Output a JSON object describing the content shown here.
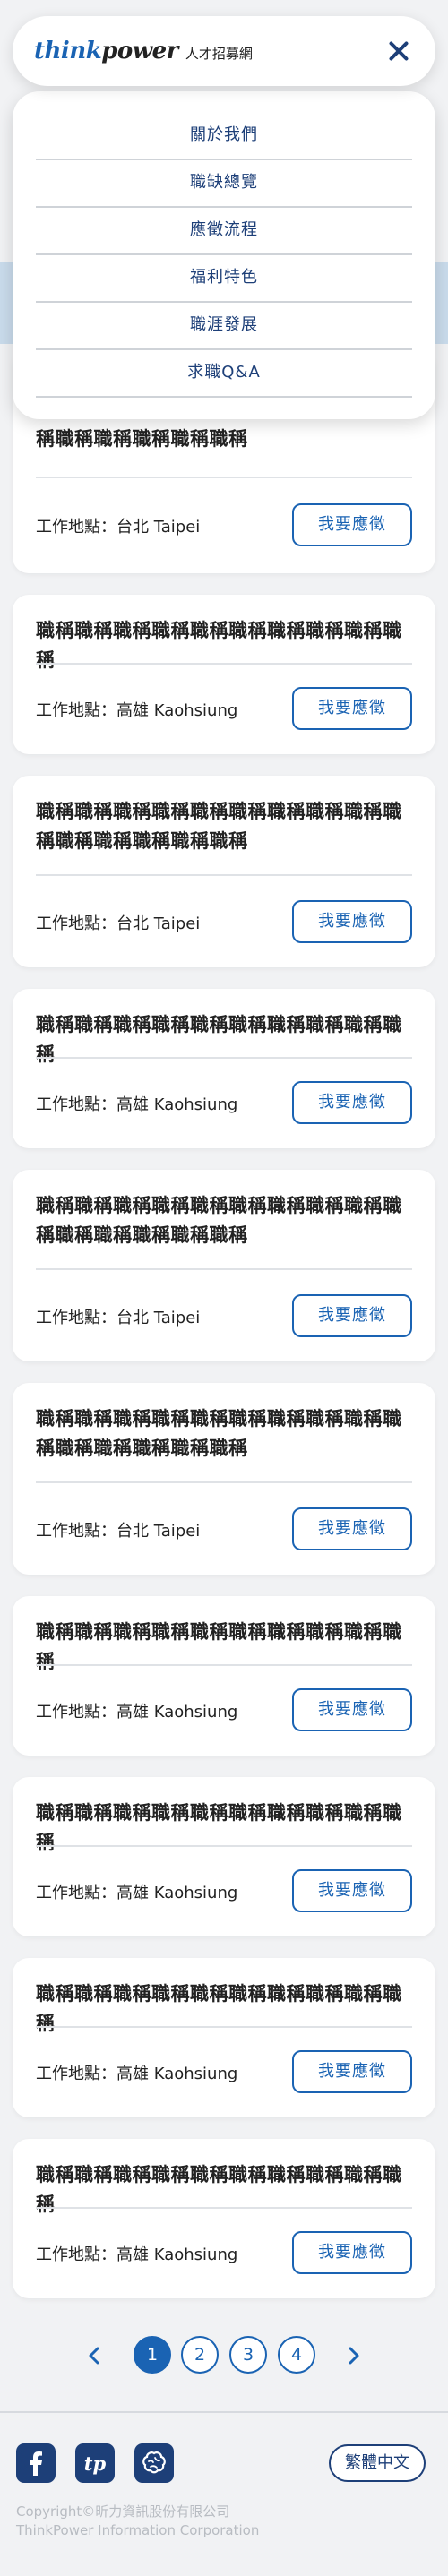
{
  "header": {
    "logo_think": "think",
    "logo_power": "power",
    "logo_sub": "人才招募網",
    "close_icon": "close-icon"
  },
  "menu": {
    "items": [
      "關於我們",
      "職缺總覽",
      "應徵流程",
      "福利特色",
      "職涯發展",
      "求職Q&A"
    ]
  },
  "jobs": [
    {
      "title": "職稱職稱職稱職稱職稱職稱職稱職稱職稱職稱職稱職稱職稱職稱職稱",
      "location_label": "工作地點：",
      "location": "台北 Taipei",
      "apply": "我要應徵"
    },
    {
      "title": "職稱職稱職稱職稱職稱職稱職稱職稱職稱職稱",
      "location_label": "工作地點：",
      "location": "高雄 Kaohsiung",
      "apply": "我要應徵"
    },
    {
      "title": "職稱職稱職稱職稱職稱職稱職稱職稱職稱職稱職稱職稱職稱職稱職稱",
      "location_label": "工作地點：",
      "location": "台北 Taipei",
      "apply": "我要應徵"
    },
    {
      "title": "職稱職稱職稱職稱職稱職稱職稱職稱職稱職稱",
      "location_label": "工作地點：",
      "location": "高雄 Kaohsiung",
      "apply": "我要應徵"
    },
    {
      "title": "職稱職稱職稱職稱職稱職稱職稱職稱職稱職稱職稱職稱職稱職稱職稱",
      "location_label": "工作地點：",
      "location": "台北 Taipei",
      "apply": "我要應徵"
    },
    {
      "title": "職稱職稱職稱職稱職稱職稱職稱職稱職稱職稱職稱職稱職稱職稱職稱",
      "location_label": "工作地點：",
      "location": "台北 Taipei",
      "apply": "我要應徵"
    },
    {
      "title": "職稱職稱職稱職稱職稱職稱職稱職稱職稱職稱",
      "location_label": "工作地點：",
      "location": "高雄 Kaohsiung",
      "apply": "我要應徵"
    },
    {
      "title": "職稱職稱職稱職稱職稱職稱職稱職稱職稱職稱",
      "location_label": "工作地點：",
      "location": "高雄 Kaohsiung",
      "apply": "我要應徵"
    },
    {
      "title": "職稱職稱職稱職稱職稱職稱職稱職稱職稱職稱",
      "location_label": "工作地點：",
      "location": "高雄 Kaohsiung",
      "apply": "我要應徵"
    },
    {
      "title": "職稱職稱職稱職稱職稱職稱職稱職稱職稱職稱",
      "location_label": "工作地點：",
      "location": "高雄 Kaohsiung",
      "apply": "我要應徵"
    }
  ],
  "pagination": {
    "pages": [
      "1",
      "2",
      "3",
      "4"
    ],
    "current": "1",
    "prev_icon": "chevron-left-icon",
    "next_icon": "chevron-right-icon"
  },
  "footer": {
    "social": [
      "facebook-icon",
      "tp-icon",
      "brain-icon"
    ],
    "tp_text": "tp",
    "lang": "繁體中文",
    "copyright": "Copyright©昕力資訊股份有限公司",
    "company_en": "ThinkPower Information Corporation"
  },
  "colors": {
    "brand_blue": "#1a63b3",
    "navy": "#1d3f78",
    "background": "#f1f2f4"
  }
}
